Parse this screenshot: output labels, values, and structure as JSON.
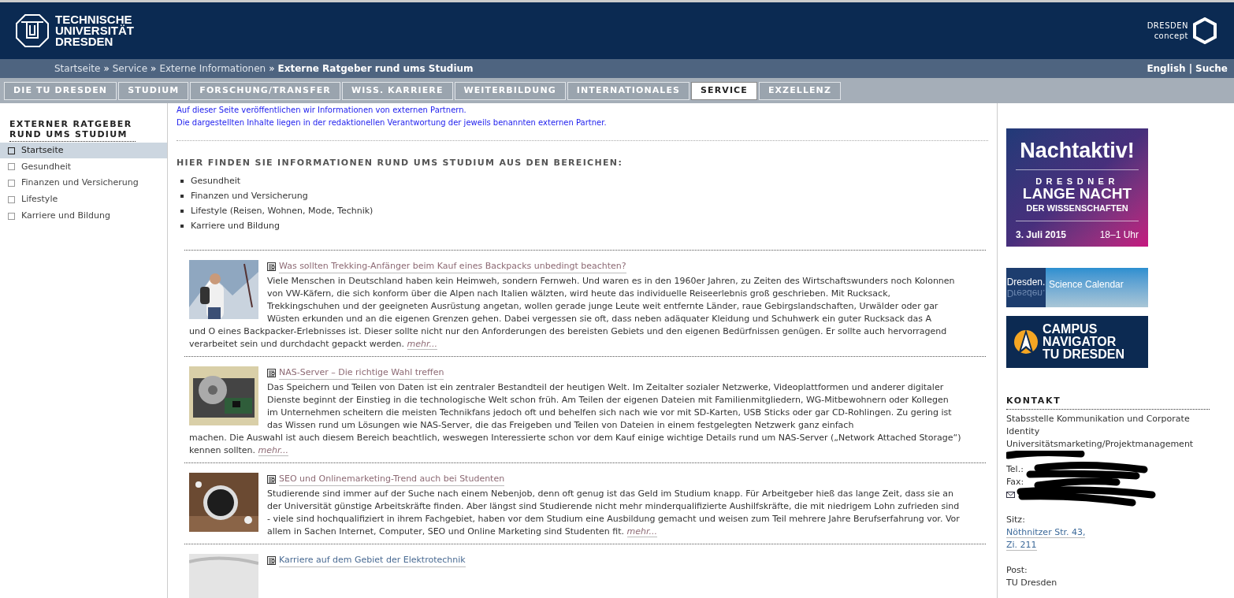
{
  "header": {
    "logo_text": [
      "TECHNISCHE",
      "UNIVERSITÄT",
      "DRESDEN"
    ],
    "concept_text": [
      "DRESDEN",
      "concept"
    ]
  },
  "breadcrumb": {
    "items": [
      "Startseite",
      "Service",
      "Externe Informationen"
    ],
    "separator": "»",
    "current": "Externe Ratgeber rund ums Studium",
    "links": [
      "English",
      "Suche"
    ],
    "link_separator": "|"
  },
  "nav_tabs": [
    {
      "label": "DIE TU DRESDEN",
      "selected": false
    },
    {
      "label": "STUDIUM",
      "selected": false
    },
    {
      "label": "FORSCHUNG/TRANSFER",
      "selected": false
    },
    {
      "label": "WISS. KARRIERE",
      "selected": false
    },
    {
      "label": "WEITERBILDUNG",
      "selected": false
    },
    {
      "label": "INTERNATIONALES",
      "selected": false
    },
    {
      "label": "SERVICE",
      "selected": true
    },
    {
      "label": "EXZELLENZ",
      "selected": false
    }
  ],
  "sidebar": {
    "title": "EXTERNER RATGEBER RUND UMS STUDIUM",
    "items": [
      {
        "label": "Startseite",
        "selected": true
      },
      {
        "label": "Gesundheit",
        "selected": false
      },
      {
        "label": "Finanzen und Versicherung",
        "selected": false
      },
      {
        "label": "Lifestyle",
        "selected": false
      },
      {
        "label": "Karriere und Bildung",
        "selected": false
      }
    ]
  },
  "notice": [
    "Auf dieser Seite veröffentlichen wir Informationen von externen Partnern.",
    "Die dargestellten Inhalte liegen in der redaktionellen Verantwortung der jeweils benannten externen Partner."
  ],
  "areas": {
    "heading": "HIER FINDEN SIE INFORMATIONEN RUND UMS STUDIUM AUS DEN BEREICHEN:",
    "items": [
      "Gesundheit",
      "Finanzen und Versicherung",
      "Lifestyle (Reisen, Wohnen, Mode, Technik)",
      "Karriere und Bildung"
    ]
  },
  "articles": [
    {
      "title": "Was sollten Trekking-Anfänger beim Kauf eines Backpacks unbedingt beachten?",
      "body": "Viele Menschen in Deutschland haben kein Heimweh, sondern Fernweh. Und waren es in den 1960er Jahren, zu Zeiten des Wirtschaftswunders noch Kolonnen von VW-Käfern, die sich konform über die Alpen nach Italien wälzten, wird heute das individuelle Reiseerlebnis groß geschrieben. Mit Rucksack, Trekkingschuhen und der geeigneten Ausrüstung angetan, wollen gerade junge Leute weit entfernte Länder, raue Gebirgslandschaften, Urwälder oder gar Wüsten erkunden und an die eigenen Grenzen gehen. Dabei vergessen sie oft, dass neben adäquater Kleidung und Schuhwerk ein guter Rucksack das A",
      "body_continued": "und O eines Backpacker-Erlebnisses ist. Dieser sollte nicht nur den Anforderungen des bereisten Gebiets und den eigenen Bedürfnissen genügen. Er sollte auch hervorragend verarbeitet sein und durchdacht gepackt werden.",
      "more": "mehr..."
    },
    {
      "title": "NAS-Server – Die richtige Wahl treffen",
      "body": "Das Speichern und Teilen von Daten ist ein zentraler Bestandteil der heutigen Welt. Im Zeitalter sozialer Netzwerke, Videoplattformen und anderer digitaler Dienste beginnt der Einstieg in die technologische Welt schon früh. Am Teilen der eigenen Dateien mit Familienmitgliedern, WG-Mitbewohnern oder Kollegen im Unternehmen scheitern die meisten Technikfans jedoch oft und behelfen sich nach wie vor mit SD-Karten, USB Sticks oder gar CD-Rohlingen. Zu gering ist das Wissen rund um Lösungen wie NAS-Server, die das Freigeben und Teilen von Dateien in einem festgelegten Netzwerk ganz einfach",
      "body_continued": "machen. Die Auswahl ist auch diesem Bereich beachtlich, weswegen Interessierte schon vor dem Kauf einige wichtige Details rund um NAS-Server („Network Attached Storage“) kennen sollten.",
      "more": "mehr..."
    },
    {
      "title": "SEO und Onlinemarketing-Trend auch bei Studenten",
      "body": "Studierende sind immer auf der Suche nach einem Nebenjob, denn oft genug ist das Geld im Studium knapp. Für Arbeitgeber hieß das lange Zeit, dass sie an der Universität günstige Arbeitskräfte finden. Aber längst sind Studierende nicht mehr minderqualifizierte Aushilfskräfte, die mit niedrigem Lohn zufrieden sind - viele sind hochqualifiziert in ihrem Fachgebiet, haben vor dem Studium eine Ausbildung gemacht und weisen zum Teil mehrere Jahre Berufserfahrung vor. Vor allem in Sachen Internet, Computer, SEO und Online Marketing sind Studenten fit.",
      "more": "mehr..."
    },
    {
      "title": "Karriere auf dem Gebiet der Elektrotechnik"
    }
  ],
  "banners": [
    {
      "kind": "event",
      "title": "Nachtaktiv!",
      "kicker": "DRESDNER",
      "headline": "LANGE NACHT",
      "subline": "DER WISSENSCHAFTEN",
      "date": "3. Juli 2015",
      "time": "18–1 Uhr"
    },
    {
      "kind": "calendar",
      "brand": "Dresden.",
      "mirror": "Dresden.",
      "label": "Science Calendar"
    },
    {
      "kind": "navigator",
      "lines": [
        "CAMPUS",
        "NAVIGATOR",
        "TU DRESDEN"
      ]
    }
  ],
  "contact": {
    "heading": "KONTAKT",
    "lines": [
      "Stabsstelle Kommunikation und Corporate Identity",
      "Universitätsmarketing/Projektmanagement"
    ],
    "tel_label": "Tel.:",
    "fax_label": "Fax:",
    "seat_label": "Sitz:",
    "seat_lines": [
      "Nöthnitzer Str. 43,",
      "Zi. 211"
    ],
    "post_label": "Post:",
    "post_lines": [
      "TU Dresden"
    ]
  }
}
